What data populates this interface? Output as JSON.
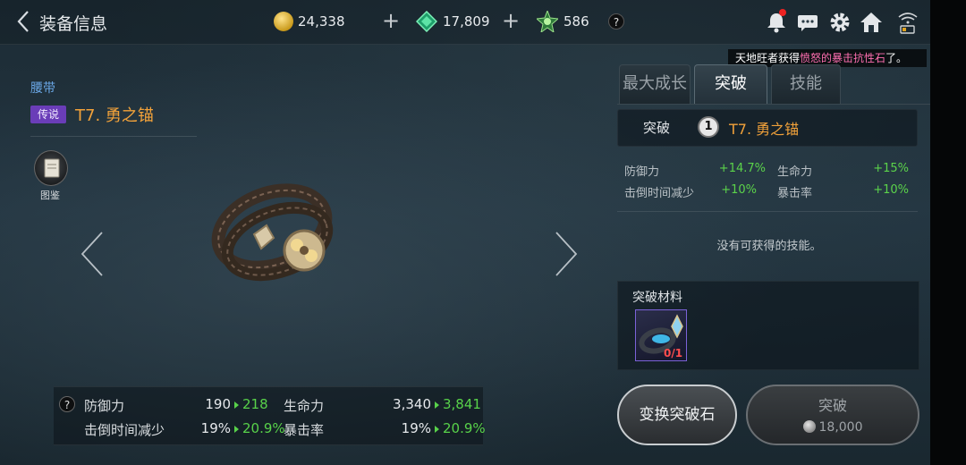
{
  "header": {
    "title": "装备信息",
    "gold": "24,338",
    "gems": "17,809",
    "stones": "586",
    "help": "?"
  },
  "marquee": {
    "prefix": "天地旺者获得",
    "highlight": "愤怒的暴击抗性石",
    "suffix": "了。"
  },
  "item": {
    "type": "腰带",
    "rarity": "传说",
    "name": "T7. 勇之锚",
    "codex_label": "图鉴"
  },
  "stats": {
    "help": "?",
    "rows": [
      {
        "label": "防御力",
        "current": "190",
        "next": "218",
        "label2": "生命力",
        "current2": "3,340",
        "next2": "3,841"
      },
      {
        "label": "击倒时间减少",
        "current": "19%",
        "next": "20.9%",
        "label2": "暴击率",
        "current2": "19%",
        "next2": "20.9%"
      }
    ]
  },
  "tabs": [
    {
      "label": "最大成长",
      "active": false
    },
    {
      "label": "突破",
      "active": true
    },
    {
      "label": "技能",
      "active": false
    }
  ],
  "breakthrough": {
    "label": "突破",
    "level": "1",
    "item_name": "T7. 勇之锚",
    "bonuses": [
      {
        "label": "防御力",
        "value": "+14.7%",
        "label2": "生命力",
        "value2": "+15%"
      },
      {
        "label": "击倒时间减少",
        "value": "+10%",
        "label2": "暴击率",
        "value2": "+10%"
      }
    ],
    "no_skill": "没有可获得的技能。",
    "materials_label": "突破材料",
    "material_count": "0/1"
  },
  "buttons": {
    "convert": "变换突破石",
    "breakthrough": "突破",
    "cost": "18,000"
  },
  "colors": {
    "accent_orange": "#f2a23a",
    "stat_green": "#58d24a",
    "rarity_purple": "#6a3db8",
    "link_blue": "#6aa7e6"
  }
}
